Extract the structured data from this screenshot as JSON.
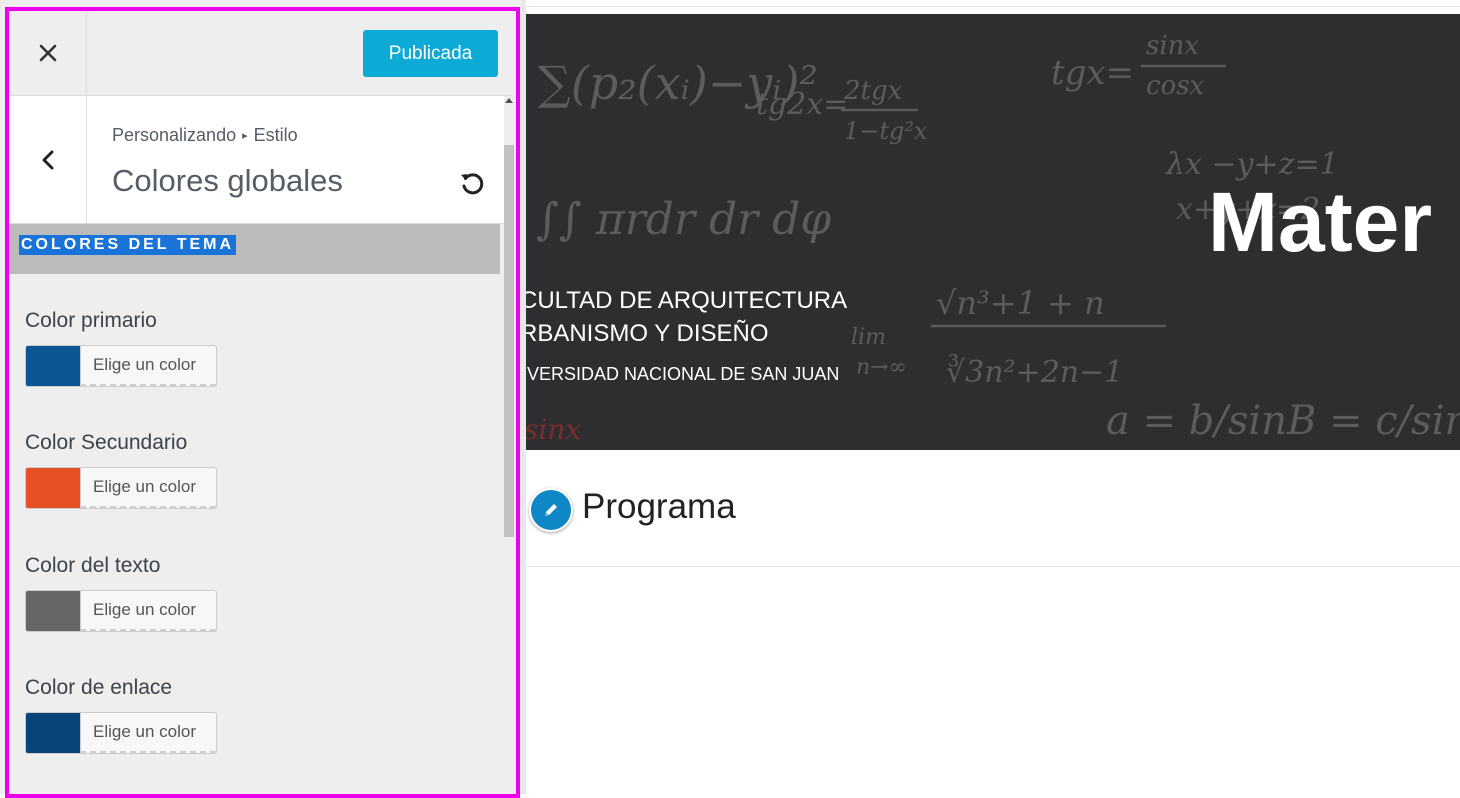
{
  "customizer": {
    "publish_label": "Publicada",
    "breadcrumb": {
      "root": "Personalizando",
      "section": "Estilo"
    },
    "panel_title": "Colores globales",
    "group_title": "COLORES DEL TEMA",
    "colors": [
      {
        "label": "Color primario",
        "button_text": "Elige un color",
        "color": "#0a5592"
      },
      {
        "label": "Color Secundario",
        "button_text": "Elige un color",
        "color": "#e65128"
      },
      {
        "label": "Color del texto",
        "button_text": "Elige un color",
        "color": "#666666"
      },
      {
        "label": "Color de enlace",
        "button_text": "Elige un color",
        "color": "#084479"
      }
    ],
    "icons": [
      "close-icon",
      "back-chevron-icon",
      "reset-icon"
    ]
  },
  "preview": {
    "hero": {
      "faculty_lines": [
        "CULTAD DE ARQUITECTURA",
        "RBANISMO Y DISEÑO"
      ],
      "university": "IVERSIDAD NACIONAL DE SAN JUAN",
      "title": "Mater"
    },
    "page_heading": "Programa",
    "icons": [
      "pencil-icon"
    ]
  },
  "theme": {
    "publish_color": "#0eaad6",
    "highlight_outline": "#ee00ee",
    "selection_color": "#1a73d9"
  }
}
